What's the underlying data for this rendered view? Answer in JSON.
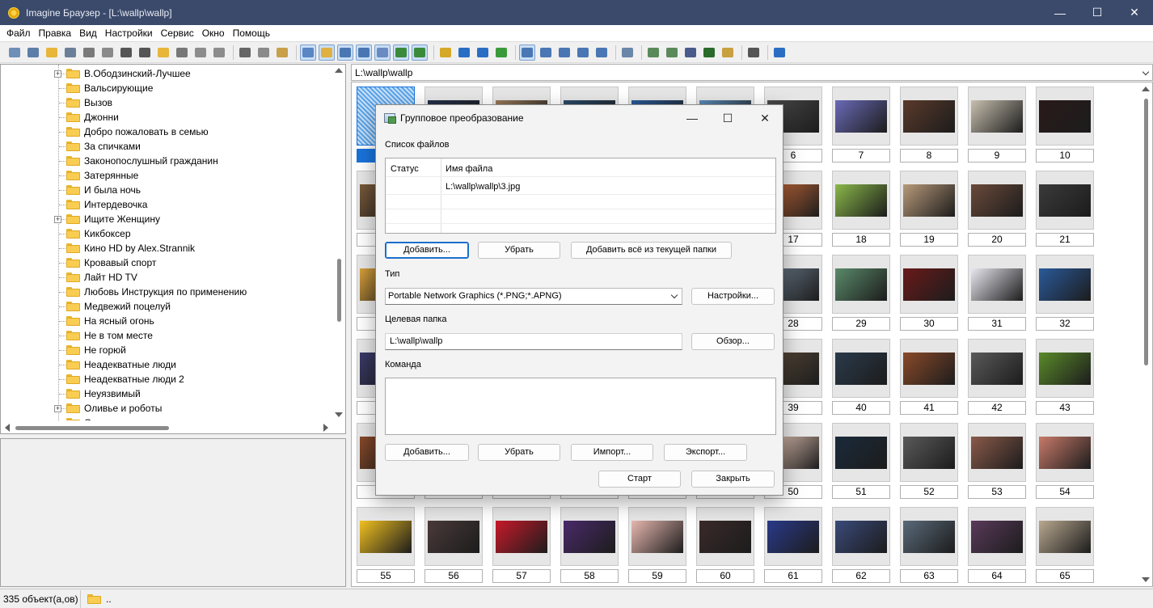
{
  "window": {
    "title": "Imagine Браузер - [L:\\wallp\\wallp]",
    "minimize": "—",
    "maximize": "☐",
    "close": "✕"
  },
  "menu": [
    "Файл",
    "Правка",
    "Вид",
    "Настройки",
    "Сервис",
    "Окно",
    "Помощь"
  ],
  "toolbar": {
    "buttons": [
      {
        "name": "view-icon",
        "color": "#6d8fb8"
      },
      {
        "name": "slideshow-icon",
        "color": "#5d7ea8"
      },
      {
        "name": "open-folder-icon",
        "color": "#e7b63a"
      },
      {
        "name": "save-icon",
        "color": "#6b7f99"
      },
      {
        "name": "print-icon",
        "color": "#7a7a7a"
      },
      {
        "name": "scan-icon",
        "color": "#8a8a8a"
      },
      {
        "name": "info-icon",
        "color": "#555555"
      },
      {
        "name": "camera-icon",
        "color": "#555555"
      },
      {
        "name": "new-folder-icon",
        "color": "#e7b63a"
      },
      {
        "name": "rename-icon",
        "color": "#777777"
      },
      {
        "name": "delete-icon",
        "color": "#8c8c8c"
      },
      {
        "name": "properties-icon",
        "color": "#8c8c8c"
      },
      "sep",
      {
        "name": "cut-icon",
        "color": "#666666"
      },
      {
        "name": "copy-icon",
        "color": "#8a8a8a"
      },
      {
        "name": "paste-icon",
        "color": "#c8a04a"
      },
      "sep",
      {
        "name": "thumbnails-view-icon",
        "color": "#5a86c4",
        "active": true
      },
      {
        "name": "tree-view-icon",
        "color": "#e0b040",
        "active": true
      },
      {
        "name": "history-icon",
        "color": "#4a77b4",
        "active": true
      },
      {
        "name": "preview-pane-icon",
        "color": "#4a77b4",
        "active": true
      },
      {
        "name": "grid-view-icon",
        "color": "#6a8ac4",
        "active": true
      },
      {
        "name": "fullscreen-icon",
        "color": "#3a8a3a",
        "active": true
      },
      {
        "name": "thumbnail-size-icon",
        "color": "#3a8a3a",
        "active": true
      },
      "sep",
      {
        "name": "parent-folder-icon",
        "color": "#d6a828"
      },
      {
        "name": "back-arrow-icon",
        "color": "#2a6ec4"
      },
      {
        "name": "forward-arrow-icon",
        "color": "#2a6ec4"
      },
      {
        "name": "refresh-icon",
        "color": "#3a9a3a"
      },
      "sep",
      {
        "name": "large-icons-view-icon",
        "color": "#4a77b4",
        "active": true
      },
      {
        "name": "small-icons-view-icon",
        "color": "#4a77b4"
      },
      {
        "name": "list-view-icon",
        "color": "#4a77b4"
      },
      {
        "name": "details-view-icon",
        "color": "#4a77b4"
      },
      {
        "name": "report-view-icon",
        "color": "#4a77b4"
      },
      "sep",
      {
        "name": "tools-wrench-icon",
        "color": "#6a86a8"
      },
      "sep",
      {
        "name": "convert-icon",
        "color": "#5a8a5a"
      },
      {
        "name": "batch-convert-icon",
        "color": "#5a8a5a"
      },
      {
        "name": "capture-icon",
        "color": "#4a5a8a"
      },
      {
        "name": "film-strip-icon",
        "color": "#2a6a2a"
      },
      {
        "name": "edit-pencil-icon",
        "color": "#c8a040"
      },
      "sep",
      {
        "name": "options-icon",
        "color": "#555555"
      },
      "sep",
      {
        "name": "help-icon",
        "color": "#2a6ec4"
      }
    ]
  },
  "tree": {
    "items": [
      {
        "label": "В.Ободзинский-Лучшее",
        "expandable": true
      },
      {
        "label": "Вальсирующие",
        "expandable": false
      },
      {
        "label": "Вызов",
        "expandable": false
      },
      {
        "label": "Джонни",
        "expandable": false
      },
      {
        "label": "Добро пожаловать в семью",
        "expandable": false
      },
      {
        "label": "За спичками",
        "expandable": false
      },
      {
        "label": "Законопослушный гражданин",
        "expandable": false
      },
      {
        "label": "Затерянные",
        "expandable": false
      },
      {
        "label": "И была ночь",
        "expandable": false
      },
      {
        "label": "Интердевочка",
        "expandable": false
      },
      {
        "label": "Ищите Женщину",
        "expandable": true
      },
      {
        "label": "Кикбоксер",
        "expandable": false
      },
      {
        "label": "Кино HD by Alex.Strannik",
        "expandable": false
      },
      {
        "label": "Кровавый спорт",
        "expandable": false
      },
      {
        "label": "Лайт HD TV",
        "expandable": false
      },
      {
        "label": "Любовь Инструкция по применению",
        "expandable": false
      },
      {
        "label": "Медвежий поцелуй",
        "expandable": false
      },
      {
        "label": "На ясный огонь",
        "expandable": false
      },
      {
        "label": "Не в том месте",
        "expandable": false
      },
      {
        "label": "Не горюй",
        "expandable": false
      },
      {
        "label": "Неадекватные люди",
        "expandable": false
      },
      {
        "label": "Неадекватные люди 2",
        "expandable": false
      },
      {
        "label": "Неуязвимый",
        "expandable": false
      },
      {
        "label": "Оливье и роботы",
        "expandable": true
      },
      {
        "label": "Открытки и картинки с поздравлениями",
        "expandable": false
      }
    ]
  },
  "path": "L:\\wallp\\wallp",
  "thumbnails": [
    {
      "n": "",
      "c": "#4a86c8",
      "selected": true
    },
    {
      "n": "",
      "c": "#24304a"
    },
    {
      "n": "",
      "c": "#9a7a5a"
    },
    {
      "n": "",
      "c": "#2a4a6a"
    },
    {
      "n": "",
      "c": "#2a5a9a"
    },
    {
      "n": "",
      "c": "#5a8ab8"
    },
    {
      "n": "6",
      "c": "#4a4a4a"
    },
    {
      "n": "7",
      "c": "#6a6ab8"
    },
    {
      "n": "8",
      "c": "#5a3a2a"
    },
    {
      "n": "9",
      "c": "#c8c0b0"
    },
    {
      "n": "10",
      "c": "#2a1a1a"
    },
    {
      "n": "",
      "c": "#7a5a3a"
    },
    {
      "n": "",
      "c": "#3a4a5a"
    },
    {
      "n": "",
      "c": "#6a5a4a"
    },
    {
      "n": "",
      "c": "#4a5a6a"
    },
    {
      "n": "",
      "c": "#5a6a7a"
    },
    {
      "n": "",
      "c": "#7a6a5a"
    },
    {
      "n": "17",
      "c": "#c86a3a"
    },
    {
      "n": "18",
      "c": "#8ab84a"
    },
    {
      "n": "19",
      "c": "#b89a7a"
    },
    {
      "n": "20",
      "c": "#6a4a3a"
    },
    {
      "n": "21",
      "c": "#3a3a3a"
    },
    {
      "n": "",
      "c": "#d8a03a"
    },
    {
      "n": "",
      "c": "#3a3a4a"
    },
    {
      "n": "",
      "c": "#5a4a3a"
    },
    {
      "n": "",
      "c": "#4a3a5a"
    },
    {
      "n": "",
      "c": "#6a6a6a"
    },
    {
      "n": "",
      "c": "#3a5a7a"
    },
    {
      "n": "28",
      "c": "#6a7a8a"
    },
    {
      "n": "29",
      "c": "#5a8a6a"
    },
    {
      "n": "30",
      "c": "#6a1a1a"
    },
    {
      "n": "31",
      "c": "#e8e8f0"
    },
    {
      "n": "32",
      "c": "#2a5a9a"
    },
    {
      "n": "",
      "c": "#3a3a6a"
    },
    {
      "n": "",
      "c": "#4a4a4a"
    },
    {
      "n": "",
      "c": "#5a5a5a"
    },
    {
      "n": "",
      "c": "#6a5a4a"
    },
    {
      "n": "",
      "c": "#4a5a4a"
    },
    {
      "n": "",
      "c": "#5a4a5a"
    },
    {
      "n": "39",
      "c": "#5a4a3a"
    },
    {
      "n": "40",
      "c": "#2a3a4a"
    },
    {
      "n": "41",
      "c": "#8a4a2a"
    },
    {
      "n": "42",
      "c": "#5a5a5a"
    },
    {
      "n": "43",
      "c": "#5a8a2a"
    },
    {
      "n": "",
      "c": "#8a4a2a"
    },
    {
      "n": "",
      "c": "#3a3a3a"
    },
    {
      "n": "",
      "c": "#5a5a6a"
    },
    {
      "n": "",
      "c": "#6a6a5a"
    },
    {
      "n": "",
      "c": "#4a4a5a"
    },
    {
      "n": "",
      "c": "#5a4a4a"
    },
    {
      "n": "50",
      "c": "#e8c8b8"
    },
    {
      "n": "51",
      "c": "#1a2a3a"
    },
    {
      "n": "52",
      "c": "#5a5a5a"
    },
    {
      "n": "53",
      "c": "#8a5a4a"
    },
    {
      "n": "54",
      "c": "#c87a6a"
    },
    {
      "n": "55",
      "c": "#f0c020"
    },
    {
      "n": "56",
      "c": "#4a3a3a"
    },
    {
      "n": "57",
      "c": "#c81a2a"
    },
    {
      "n": "58",
      "c": "#4a2a6a"
    },
    {
      "n": "59",
      "c": "#e8b8b0"
    },
    {
      "n": "60",
      "c": "#3a2a2a"
    },
    {
      "n": "61",
      "c": "#2a3a8a"
    },
    {
      "n": "62",
      "c": "#3a4a7a"
    },
    {
      "n": "63",
      "c": "#5a6a7a"
    },
    {
      "n": "64",
      "c": "#5a3a5a"
    },
    {
      "n": "65",
      "c": "#b8a890"
    }
  ],
  "status": {
    "count": "335 объект(а,ов)",
    "path": ".."
  },
  "dialog": {
    "title": "Групповое преобразование",
    "files_label": "Список файлов",
    "col_status": "Статус",
    "col_filename": "Имя файла",
    "file1": "L:\\wallp\\wallp\\3.jpg",
    "btn_add": "Добавить...",
    "btn_remove": "Убрать",
    "btn_add_all": "Добавить всё из текущей папки",
    "type_label": "Тип",
    "type_value": "Portable Network Graphics (*.PNG;*.APNG)",
    "btn_settings": "Настройки...",
    "target_label": "Целевая папка",
    "target_value": "L:\\wallp\\wallp",
    "btn_browse": "Обзор...",
    "command_label": "Команда",
    "btn_cmd_add": "Добавить...",
    "btn_cmd_remove": "Убрать",
    "btn_import": "Импорт...",
    "btn_export": "Экспорт...",
    "btn_start": "Старт",
    "btn_close": "Закрыть"
  }
}
